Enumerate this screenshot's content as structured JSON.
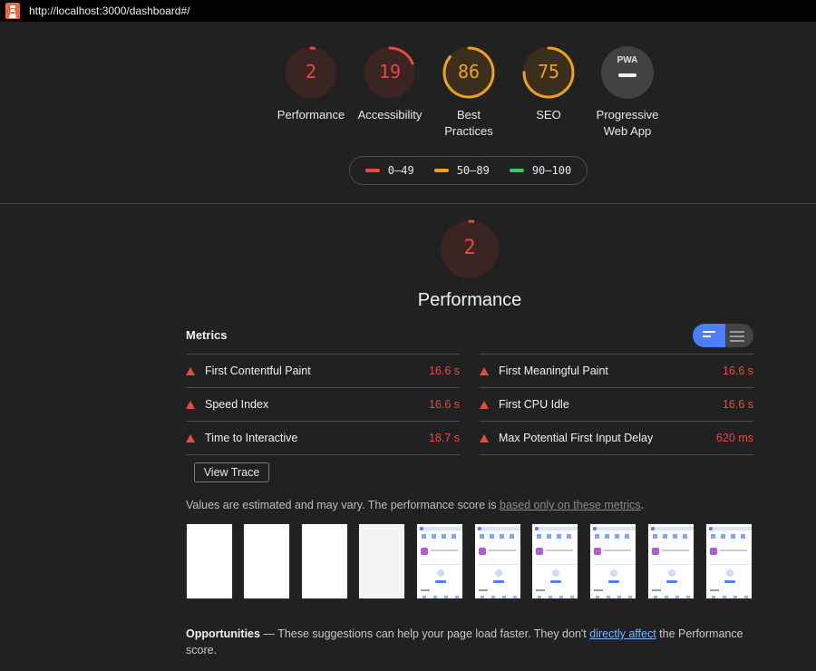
{
  "browser": {
    "url": "http://localhost:3000/dashboard#/"
  },
  "colors": {
    "fail": "#e9493e",
    "average": "#f0a01e",
    "pass": "#3fc95c",
    "accent": "#4b7fff"
  },
  "gauges": [
    {
      "score": "2",
      "label": "Performance",
      "level": 0.02,
      "status": "fail"
    },
    {
      "score": "19",
      "label": "Accessibility",
      "level": 0.19,
      "status": "fail"
    },
    {
      "score": "86",
      "label_line1": "Best",
      "label_line2": "Practices",
      "level": 0.86,
      "status": "average"
    },
    {
      "score": "75",
      "label": "SEO",
      "level": 0.75,
      "status": "average"
    },
    {
      "badge": "PWA",
      "label_line1": "Progressive",
      "label_line2": "Web App"
    }
  ],
  "legend": [
    {
      "range": "0–49",
      "status": "fail"
    },
    {
      "range": "50–89",
      "status": "average"
    },
    {
      "range": "90–100",
      "status": "pass"
    }
  ],
  "performance": {
    "score": "2",
    "level": 0.02,
    "title": "Performance",
    "metrics_heading": "Metrics",
    "metrics_left": [
      {
        "name": "First Contentful Paint",
        "value": "16.6 s"
      },
      {
        "name": "Speed Index",
        "value": "16.6 s"
      },
      {
        "name": "Time to Interactive",
        "value": "18.7 s"
      }
    ],
    "metrics_right": [
      {
        "name": "First Meaningful Paint",
        "value": "16.6 s"
      },
      {
        "name": "First CPU Idle",
        "value": "16.6 s"
      },
      {
        "name": "Max Potential First Input Delay",
        "value": "620 ms"
      }
    ],
    "view_trace_label": "View Trace",
    "estimate_text": "Values are estimated and may vary. The performance score is ",
    "estimate_link": "based only on these metrics",
    "estimate_end": "."
  },
  "opportunities": {
    "title": "Opportunities",
    "dash": " — ",
    "text1": "These suggestions can help your page load faster. They don't ",
    "link": "directly affect",
    "text2": " the Performance score."
  }
}
